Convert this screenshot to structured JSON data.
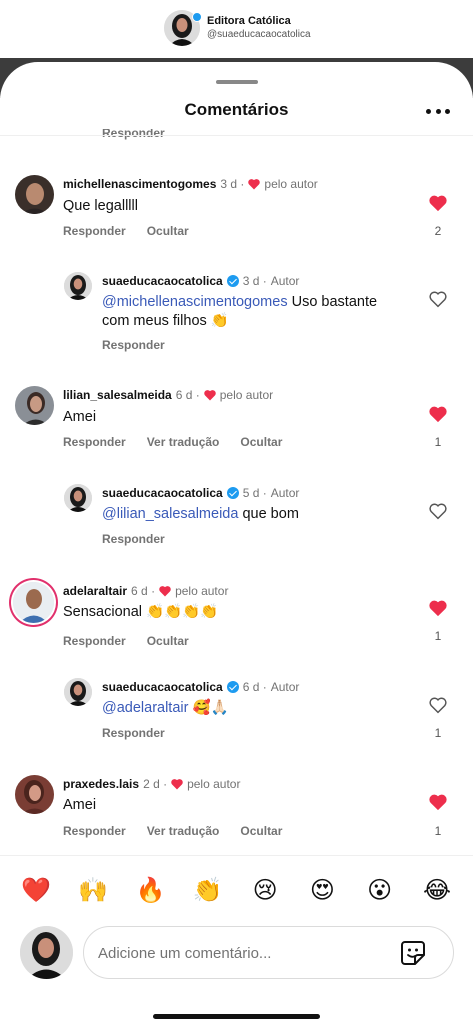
{
  "profile": {
    "title": "Editora Católica",
    "handle": "@suaeducacaocatolica"
  },
  "sheet": {
    "title": "Comentários",
    "partial_reply": "Responder"
  },
  "comments": [
    {
      "user": "michellenascimentogomes",
      "time": "3 d ·",
      "liked_by": "pelo autor",
      "text": "Que legalllll",
      "actions": [
        "Responder",
        "Ocultar"
      ],
      "likes": "2",
      "liked": true
    },
    {
      "user": "suaeducacaocatolica",
      "time": "3 d ·",
      "role": "Autor",
      "mention": "@michellenascimentogomes",
      "text": " Uso bastante",
      "text2": "com meus filhos 👏",
      "actions": [
        "Responder"
      ],
      "likes": "",
      "liked": false
    },
    {
      "user": "lilian_salesalmeida",
      "time": "6 d ·",
      "liked_by": "pelo autor",
      "text": "Amei",
      "actions": [
        "Responder",
        "Ver tradução",
        "Ocultar"
      ],
      "likes": "1",
      "liked": true
    },
    {
      "user": "suaeducacaocatolica",
      "time": "5 d ·",
      "role": "Autor",
      "mention": "@lilian_salesalmeida",
      "text": " que bom",
      "actions": [
        "Responder"
      ],
      "likes": "",
      "liked": false
    },
    {
      "user": "adelaraltair",
      "time": "6 d ·",
      "liked_by": "pelo autor",
      "text": "Sensacional 👏👏👏👏",
      "actions": [
        "Responder",
        "Ocultar"
      ],
      "likes": "1",
      "liked": true
    },
    {
      "user": "suaeducacaocatolica",
      "time": "6 d ·",
      "role": "Autor",
      "mention": "@adelaraltair",
      "text": " 🥰🙏🏻",
      "actions": [
        "Responder"
      ],
      "likes": "1",
      "liked": false
    },
    {
      "user": "praxedes.lais",
      "time": "2 d ·",
      "liked_by": "pelo autor",
      "text": "Amei",
      "actions": [
        "Responder",
        "Ver tradução",
        "Ocultar"
      ],
      "likes": "1",
      "liked": true
    }
  ],
  "emojis": [
    "❤️",
    "🙌",
    "🔥",
    "👏",
    "😢",
    "😍",
    "😮",
    "😂"
  ],
  "composer": {
    "placeholder": "Adicione um comentário..."
  },
  "colors": {
    "heart_red": "#ed2e4c",
    "mention_blue": "#3a5ab8",
    "verified_blue": "#1d9bf0",
    "muted_gray": "#737373"
  }
}
